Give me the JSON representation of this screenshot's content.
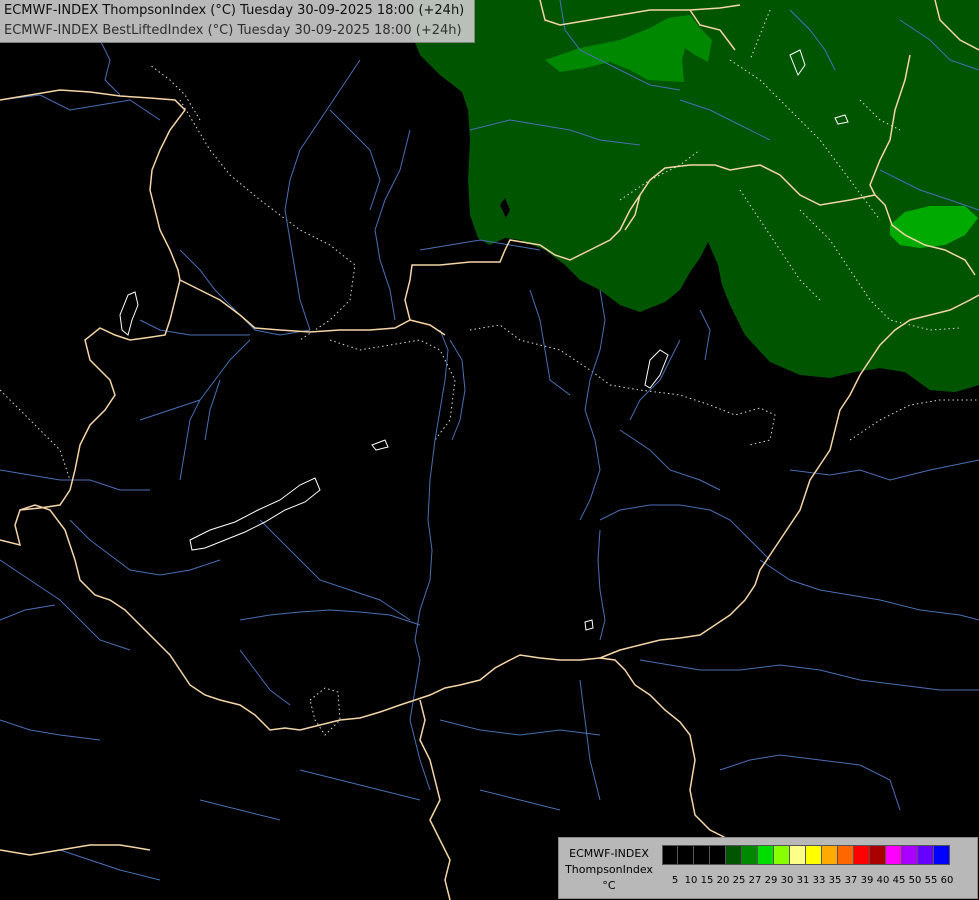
{
  "header": {
    "line1": "ECMWF-INDEX ThompsonIndex (°C) Tuesday 30-09-2025 18:00 (+24h)",
    "line2": "ECMWF-INDEX BestLiftedIndex (°C) Tuesday 30-09-2025 18:00 (+24h)"
  },
  "legend": {
    "title1": "ECMWF-INDEX",
    "title2": "ThompsonIndex",
    "unit": "°C",
    "ticks": [
      "5",
      "10",
      "15",
      "20",
      "25",
      "27",
      "29",
      "30",
      "31",
      "33",
      "35",
      "37",
      "39",
      "40",
      "45",
      "50",
      "55",
      "60"
    ],
    "colors": [
      "#000000",
      "#000000",
      "#000000",
      "#000000",
      "#005500",
      "#008800",
      "#00dd00",
      "#88ff00",
      "#ffff88",
      "#ffff00",
      "#ffaa00",
      "#ff6600",
      "#ff0000",
      "#aa0000",
      "#ff00ff",
      "#aa00ff",
      "#6600ff",
      "#0000ff"
    ]
  },
  "colors": {
    "background": "#000000",
    "border": "#f5d6a6",
    "river": "#4a6fb5",
    "dark_green": "#005500",
    "mid_green": "#008800",
    "bright_green": "#00bb00",
    "contour": "#dddddd"
  }
}
